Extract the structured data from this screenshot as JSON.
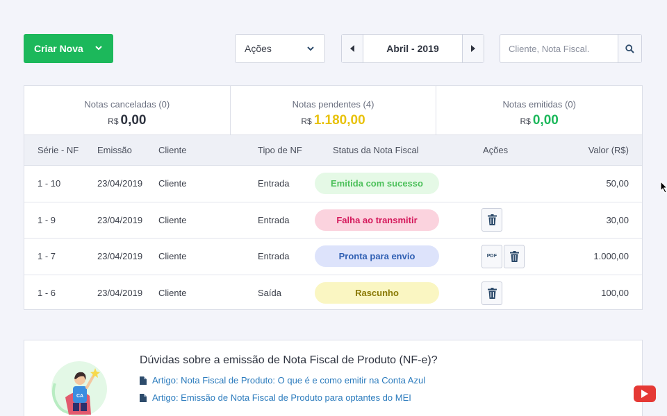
{
  "toolbar": {
    "create_label": "Criar Nova",
    "actions_label": "Ações",
    "month_label": "Abril - 2019",
    "search_placeholder": "Cliente, Nota Fiscal."
  },
  "summary": [
    {
      "label": "Notas canceladas (0)",
      "currency": "R$",
      "value": "0,00",
      "color": "#2f3440"
    },
    {
      "label": "Notas pendentes (4)",
      "currency": "R$",
      "value": "1.180,00",
      "color": "#e8c20e"
    },
    {
      "label": "Notas emitidas (0)",
      "currency": "R$",
      "value": "0,00",
      "color": "#1cb85b"
    }
  ],
  "table": {
    "headers": [
      "Série - NF",
      "Emissão",
      "Cliente",
      "Tipo de NF",
      "Status da Nota Fiscal",
      "Ações",
      "Valor (R$)"
    ],
    "rows": [
      {
        "serie": "1 - 10",
        "emissao": "23/04/2019",
        "cliente": "Cliente",
        "tipo": "Entrada",
        "status": "Emitida com sucesso",
        "valor": "50,00"
      },
      {
        "serie": "1 - 9",
        "emissao": "23/04/2019",
        "cliente": "Cliente",
        "tipo": "Entrada",
        "status": "Falha ao transmitir",
        "valor": "30,00"
      },
      {
        "serie": "1 - 7",
        "emissao": "23/04/2019",
        "cliente": "Cliente",
        "tipo": "Entrada",
        "status": "Pronta para envio",
        "valor": "1.000,00"
      },
      {
        "serie": "1 - 6",
        "emissao": "23/04/2019",
        "cliente": "Cliente",
        "tipo": "Saída",
        "status": "Rascunho",
        "valor": "100,00"
      }
    ],
    "pdf_label": "PDF"
  },
  "status_colors": {
    "success_bg": "#e5f9e6",
    "success_fg": "#4cc05a",
    "fail_bg": "#fbd3de",
    "fail_fg": "#d4175a",
    "ready_bg": "#dde3fb",
    "ready_fg": "#2f5fb3",
    "draft_bg": "#faf6c2",
    "draft_fg": "#8a7a05"
  },
  "help": {
    "title": "Dúvidas sobre a emissão de Nota Fiscal de Produto (NF-e)?",
    "links": [
      "Artigo: Nota Fiscal de Produto: O que é e como emitir na Conta Azul",
      "Artigo: Emissão de Nota Fiscal de Produto para optantes do MEI"
    ],
    "avatar_badge": "CA"
  },
  "icons": [
    "chevron-down-icon",
    "arrow-left-icon",
    "arrow-right-icon",
    "search-icon",
    "trash-icon",
    "pdf-icon",
    "document-icon",
    "youtube-icon",
    "cursor-icon"
  ]
}
